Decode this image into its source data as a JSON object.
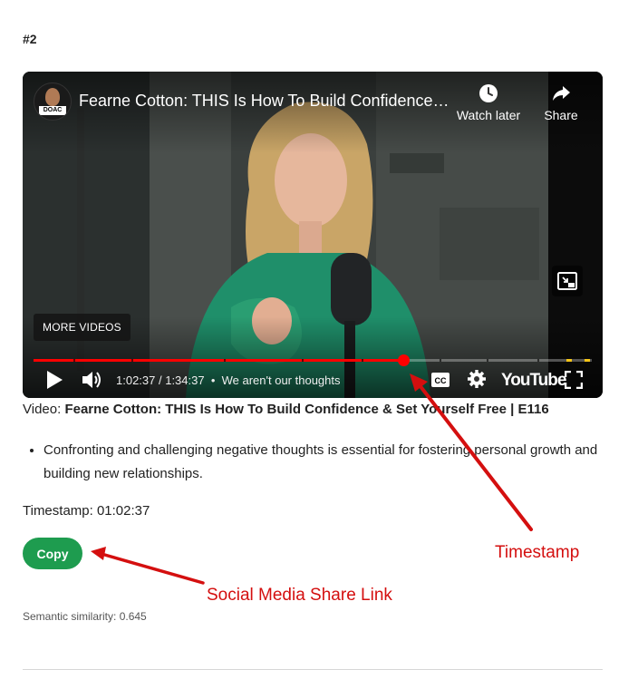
{
  "rank_label": "#2",
  "video": {
    "title": "Fearne Cotton: THIS Is How To Build Confidence ...",
    "channel_badge": "DOAC",
    "watch_later_label": "Watch later",
    "share_label": "Share",
    "more_videos_label": "MORE VIDEOS",
    "current_time": "1:02:37",
    "duration": "1:34:37",
    "time_display": "1:02:37 / 1:34:37",
    "chapter_title": "We aren't our thoughts",
    "progress_fraction": 0.662,
    "youtube_logo": "YouTube",
    "cc_label": "CC"
  },
  "caption": {
    "prefix": "Video: ",
    "title": "Fearne Cotton: THIS Is How To Build Confidence & Set Yourself Free | E116"
  },
  "bullets": [
    "Confronting and challenging negative thoughts is essential for fostering personal growth and building new relationships."
  ],
  "timestamp_line": "Timestamp: 01:02:37",
  "copy_button_label": "Copy",
  "similarity_text": "Semantic similarity: 0.645",
  "annotations": {
    "timestamp_label": "Timestamp",
    "share_link_label": "Social Media Share Link",
    "color": "#d40f0f"
  },
  "colors": {
    "progress_played": "#ff0000",
    "copy_button": "#1e9c4f"
  }
}
